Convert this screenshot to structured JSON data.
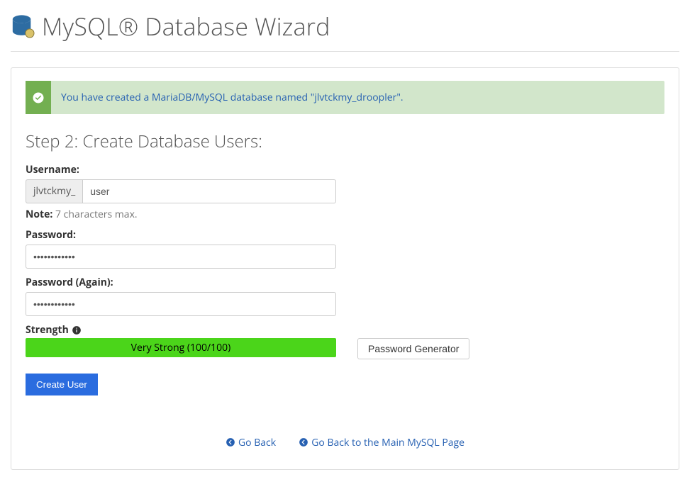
{
  "header": {
    "title": "MySQL® Database Wizard"
  },
  "alert": {
    "message": "You have created a MariaDB/MySQL database named \"jlvtckmy_droopler\"."
  },
  "step_title": "Step 2: Create Database Users:",
  "fields": {
    "username": {
      "label": "Username:",
      "prefix": "jlvtckmy_",
      "value": "user"
    },
    "note": {
      "label": "Note:",
      "text": "7 characters max."
    },
    "password": {
      "label": "Password:",
      "value": "••••••••••••"
    },
    "password2": {
      "label": "Password (Again):",
      "value": "••••••••••••"
    },
    "strength": {
      "label": "Strength",
      "meter": "Very Strong (100/100)",
      "percent": 100
    }
  },
  "buttons": {
    "pwgen": "Password Generator",
    "create": "Create User"
  },
  "links": {
    "goback": "Go Back",
    "mainpage": "Go Back to the Main MySQL Page"
  }
}
